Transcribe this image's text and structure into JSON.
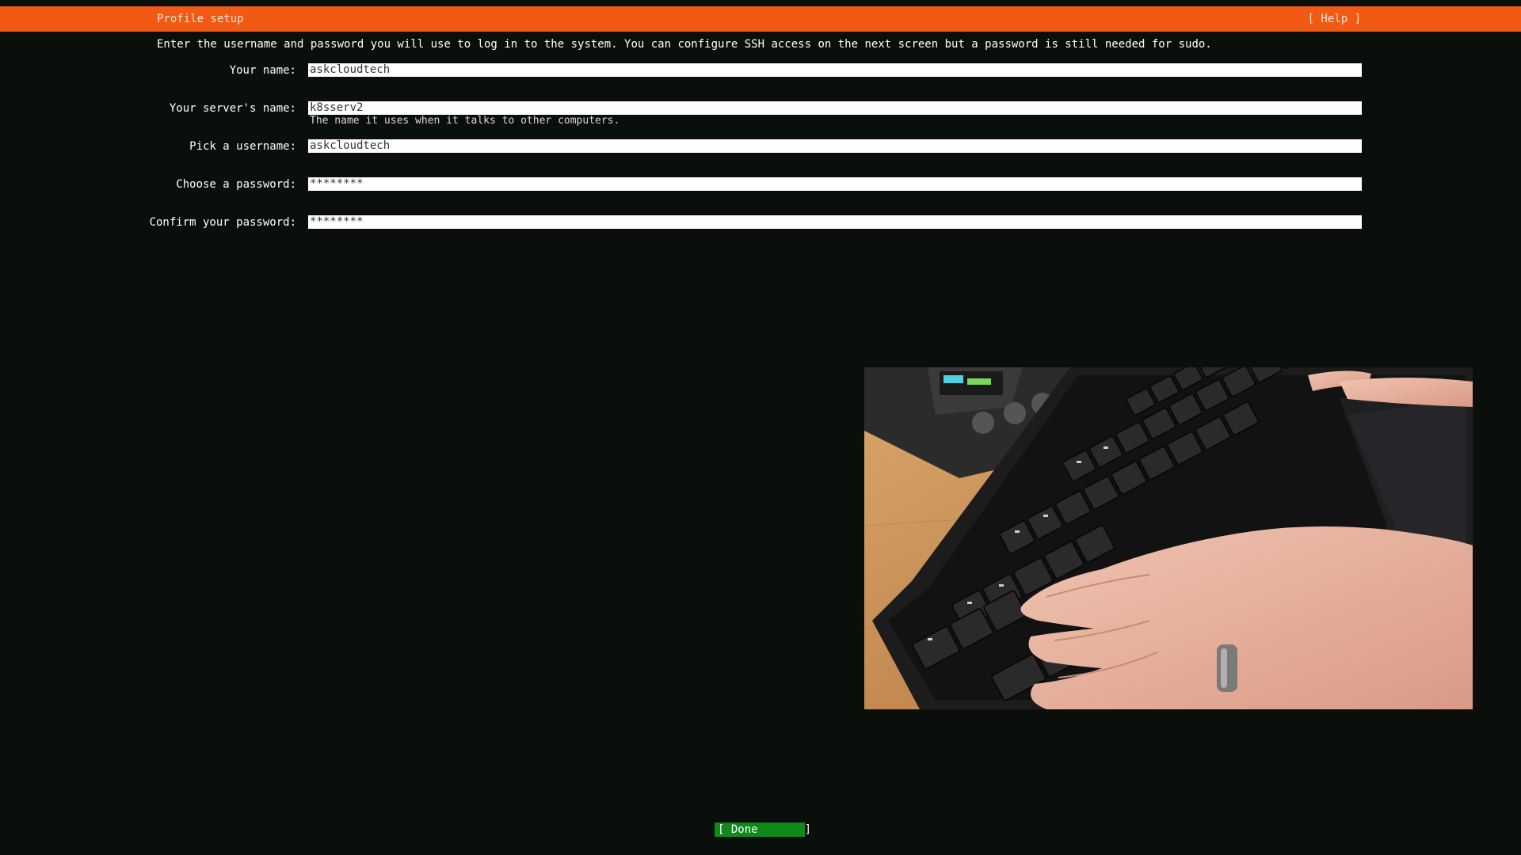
{
  "header": {
    "title": "Profile setup",
    "help": "[ Help ]"
  },
  "intro": "Enter the username and password you will use to log in to the system. You can configure SSH access on the next screen but a password is still needed for sudo.",
  "form": {
    "your_name": {
      "label": "Your name:",
      "value": "askcloudtech"
    },
    "server_name": {
      "label": "Your server's name:",
      "value": "k8sserv2",
      "hint": "The name it uses when it talks to other computers."
    },
    "username": {
      "label": "Pick a username:",
      "value": "askcloudtech"
    },
    "password": {
      "label": "Choose a password:",
      "value": "********"
    },
    "confirm_password": {
      "label": "Confirm your password:",
      "value": "********"
    }
  },
  "done_button": "[ Done       ]",
  "colors": {
    "accent": "#f05a14",
    "background": "#0a0f0c",
    "done": "#0f8a1a"
  }
}
